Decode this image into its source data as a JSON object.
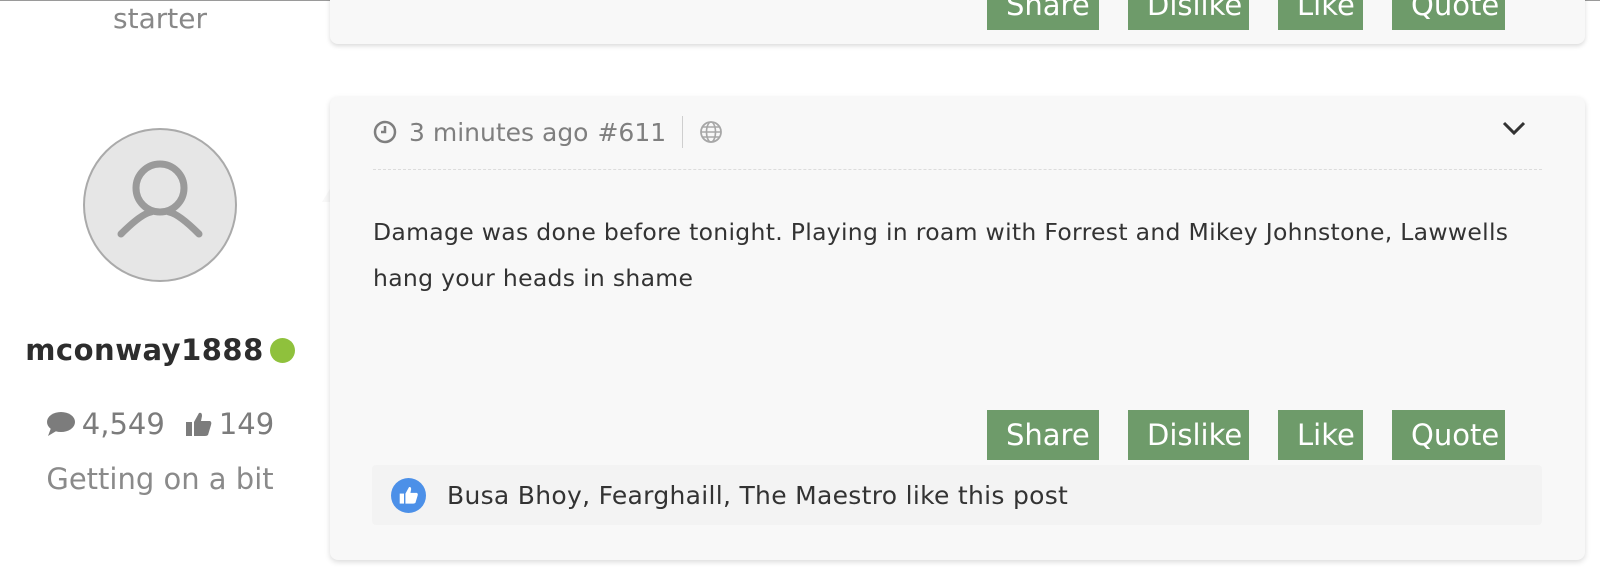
{
  "previous_post": {
    "user_rank": "starter",
    "actions": [
      "Share",
      "Dislike",
      "Like",
      "Quote"
    ]
  },
  "post": {
    "user": {
      "username": "mconway1888",
      "online": true,
      "message_count": "4,549",
      "like_count": "149",
      "rank": "Getting on a bit"
    },
    "time_ago": "3 minutes ago",
    "post_number": "#611",
    "body": "Damage was done before tonight. Playing in roam with Forrest and Mikey Johnstone, Lawwells hang your heads in shame",
    "actions": [
      "Share",
      "Dislike",
      "Like",
      "Quote"
    ],
    "likes_text": "Busa Bhoy, Fearghaill, The Maestro like this post"
  },
  "icons": {
    "clock": "clock-icon",
    "globe": "globe-icon",
    "chevron": "chevron-down-icon",
    "messages": "speech-bubble-icon",
    "likes": "thumbs-up-icon"
  },
  "colors": {
    "button": "#6e9b6a",
    "online": "#8fc13c",
    "like_badge": "#4c90e8",
    "card_bg": "#f8f8f8"
  }
}
